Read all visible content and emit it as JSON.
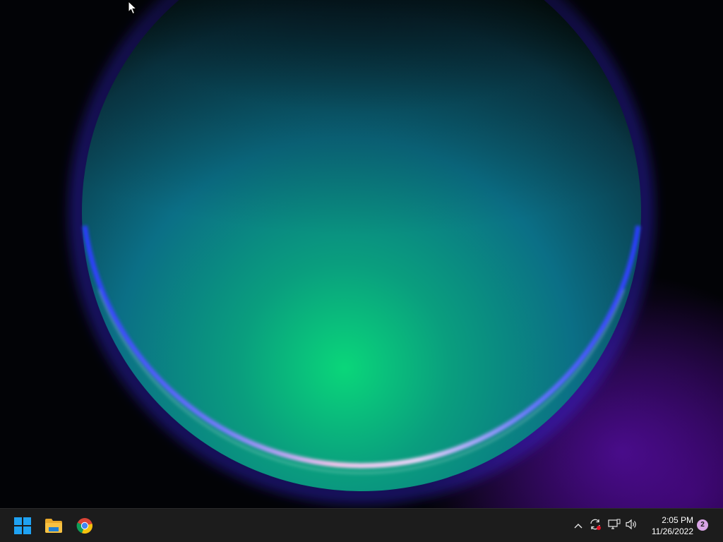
{
  "desktop": {
    "wallpaper": "windows-11-bloom-wallpaper"
  },
  "taskbar": {
    "apps": [
      {
        "name": "start-button",
        "icon": "windows-logo-icon"
      },
      {
        "name": "file-explorer",
        "icon": "folder-icon"
      },
      {
        "name": "google-chrome",
        "icon": "chrome-icon"
      }
    ],
    "tray": {
      "overflow_icon": "chevron-up-icon",
      "sync_icon": "sync-icon",
      "network_icon": "network-icon",
      "volume_icon": "speaker-icon"
    },
    "clock": {
      "time": "2:05 PM",
      "date": "11/26/2022"
    },
    "notifications": {
      "count": "2"
    }
  },
  "colors": {
    "taskbar_bg": "#1c1c1c",
    "windows_blue": "#1fa2f3",
    "folder_yellow": "#f7c142",
    "notif_badge": "#d9a5e6"
  }
}
